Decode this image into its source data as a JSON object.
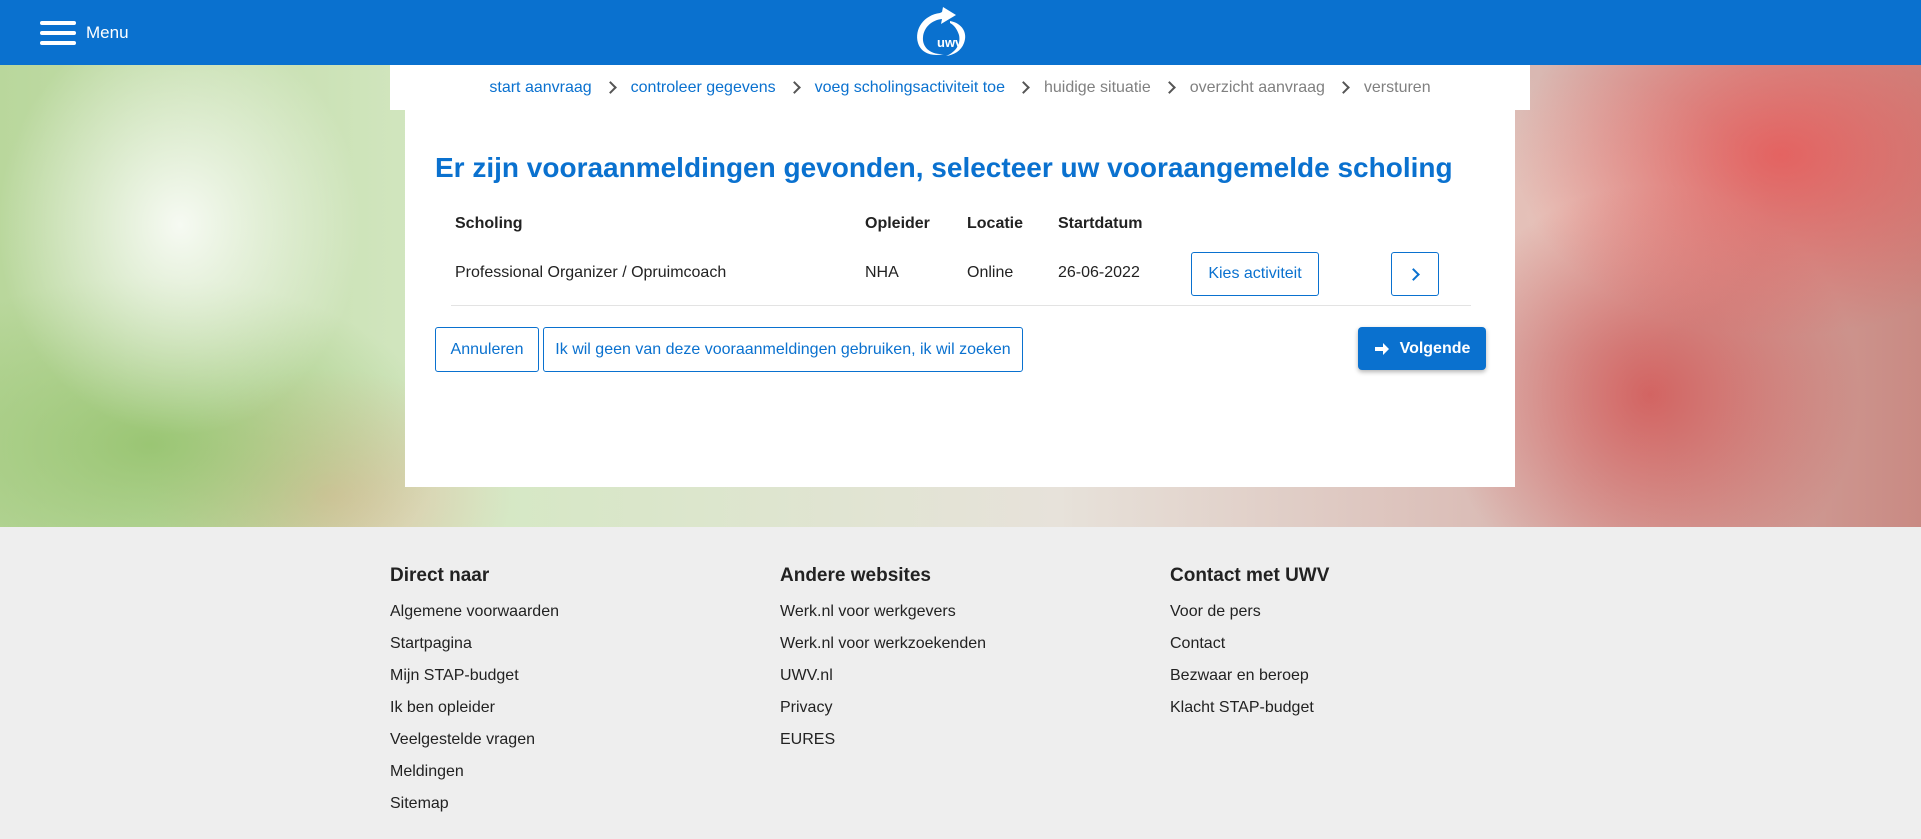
{
  "header": {
    "menu_label": "Menu",
    "logo_text": "uwv",
    "brand_color": "#0a71cf"
  },
  "breadcrumb": [
    {
      "label": "start aanvraag",
      "active": true
    },
    {
      "label": "controleer gegevens",
      "active": true
    },
    {
      "label": "voeg scholingsactiviteit toe",
      "active": true
    },
    {
      "label": "huidige situatie",
      "active": false
    },
    {
      "label": "overzicht aanvraag",
      "active": false
    },
    {
      "label": "versturen",
      "active": false
    }
  ],
  "main": {
    "title": "Er zijn vooraanmeldingen gevonden, selecteer uw vooraangemelde scholing",
    "table": {
      "columns": [
        "Scholing",
        "Opleider",
        "Locatie",
        "Startdatum"
      ],
      "rows": [
        {
          "scholing": "Professional Organizer / Opruimcoach",
          "opleider": "NHA",
          "locatie": "Online",
          "startdatum": "26-06-2022",
          "select_label": "Kies activiteit",
          "details_icon": "chevron-right-icon"
        }
      ]
    },
    "buttons": {
      "cancel": "Annuleren",
      "search_instead": "Ik wil geen van deze vooraanmeldingen gebruiken, ik wil zoeken",
      "next": "Volgende",
      "next_icon": "arrow-right-icon"
    }
  },
  "footer": {
    "columns": [
      {
        "heading": "Direct naar",
        "links": [
          "Algemene voorwaarden",
          "Startpagina",
          "Mijn STAP-budget",
          "Ik ben opleider",
          "Veelgestelde vragen",
          "Meldingen",
          "Sitemap"
        ]
      },
      {
        "heading": "Andere websites",
        "links": [
          "Werk.nl voor werkgevers",
          "Werk.nl voor werkzoekenden",
          "UWV.nl",
          "Privacy",
          "EURES"
        ]
      },
      {
        "heading": "Contact met UWV",
        "links": [
          "Voor de pers",
          "Contact",
          "Bezwaar en beroep",
          "Klacht STAP-budget"
        ]
      }
    ]
  }
}
